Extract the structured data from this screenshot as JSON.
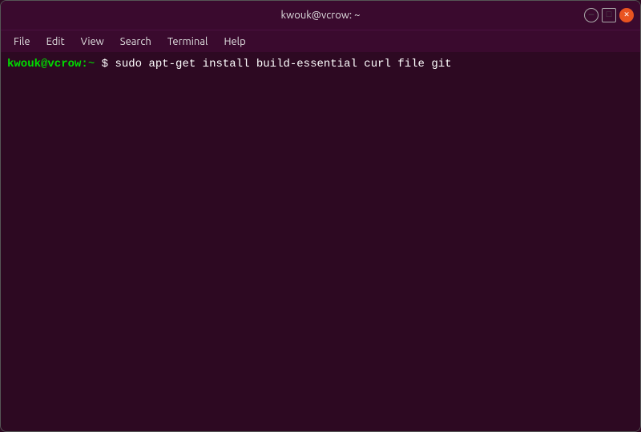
{
  "window": {
    "title": "kwouk@vcrow: ~",
    "controls": {
      "minimize_label": "–",
      "maximize_label": "□",
      "close_label": "✕"
    }
  },
  "menubar": {
    "items": [
      "File",
      "Edit",
      "View",
      "Search",
      "Terminal",
      "Help"
    ]
  },
  "terminal": {
    "prompt_user": "kwouk@vcrow:",
    "prompt_separator": "~",
    "prompt_dollar": "$",
    "command": " sudo apt-get install build-essential curl file git"
  }
}
